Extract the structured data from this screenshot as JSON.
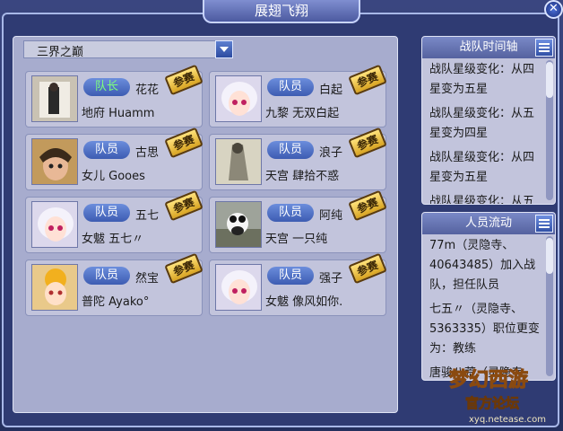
{
  "window": {
    "title": "展翅飞翔",
    "close_glyph": "✕"
  },
  "team_selector": {
    "value": "三界之巅"
  },
  "badge_text": "参赛",
  "members": [
    {
      "role": "队长",
      "name": "花花",
      "server": "地府",
      "char": "Huamm",
      "leader": true
    },
    {
      "role": "队员",
      "name": "白起",
      "server": "九黎",
      "char": "无双白起",
      "leader": false
    },
    {
      "role": "队员",
      "name": "古思",
      "server": "女儿",
      "char": "Gooes",
      "leader": false
    },
    {
      "role": "队员",
      "name": "浪子",
      "server": "天宫",
      "char": "肆拾不惑",
      "leader": false
    },
    {
      "role": "队员",
      "name": "五七",
      "server": "女魃",
      "char": "五七〃",
      "leader": false
    },
    {
      "role": "队员",
      "name": "阿纯",
      "server": "天宫",
      "char": "一只纯",
      "leader": false
    },
    {
      "role": "队员",
      "name": "然宝",
      "server": "普陀",
      "char": "Ayako°",
      "leader": false
    },
    {
      "role": "队员",
      "name": "强子",
      "server": "女魃",
      "char": "像风如你.",
      "leader": false
    }
  ],
  "timeline": {
    "title": "战队时间轴",
    "entries": [
      "战队星级变化：从四星变为五星",
      "战队星级变化：从五星变为四星",
      "战队星级变化：从四星变为五星",
      "战队星级变化：从五"
    ]
  },
  "staff": {
    "title": "人员流动",
    "entries": [
      "77m（灵隐寺、40643485）加入战队，担任队员",
      "七五〃（灵隐寺、5363335）职位更变为：教练",
      "唐骏八荒（灵隐寺"
    ]
  },
  "watermark": {
    "logo": "梦幻西游",
    "subtitle": "官方论坛",
    "url": "xyq.netease.com"
  }
}
